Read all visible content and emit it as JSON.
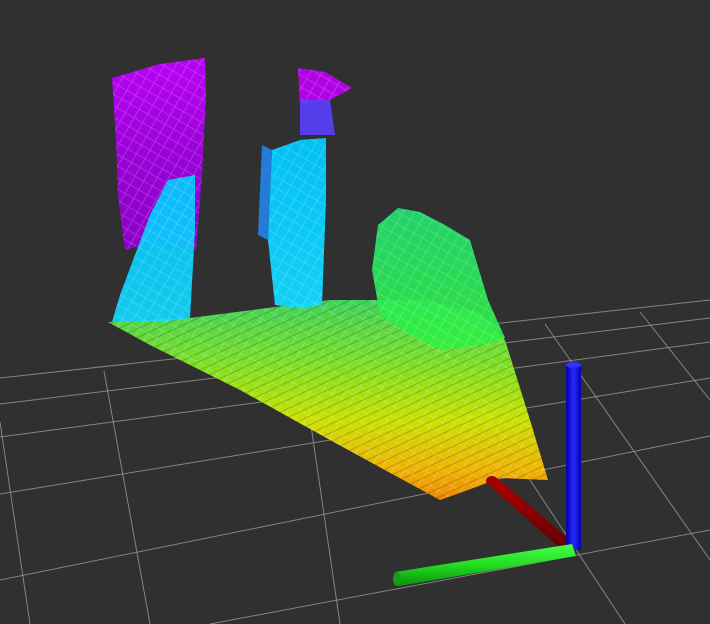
{
  "viewport": {
    "background": "#303030",
    "grid_color": "#a0a0a0"
  },
  "point_cloud": {
    "color_map": [
      "#ff8c00",
      "#ffd000",
      "#c8f000",
      "#00e05a",
      "#00d0ff",
      "#1ea0ff",
      "#b010ff"
    ],
    "color_field": "distance"
  },
  "axes": {
    "x_color": "#22dd22",
    "y_color": "#1414ff",
    "z_color": "#8b0000"
  }
}
